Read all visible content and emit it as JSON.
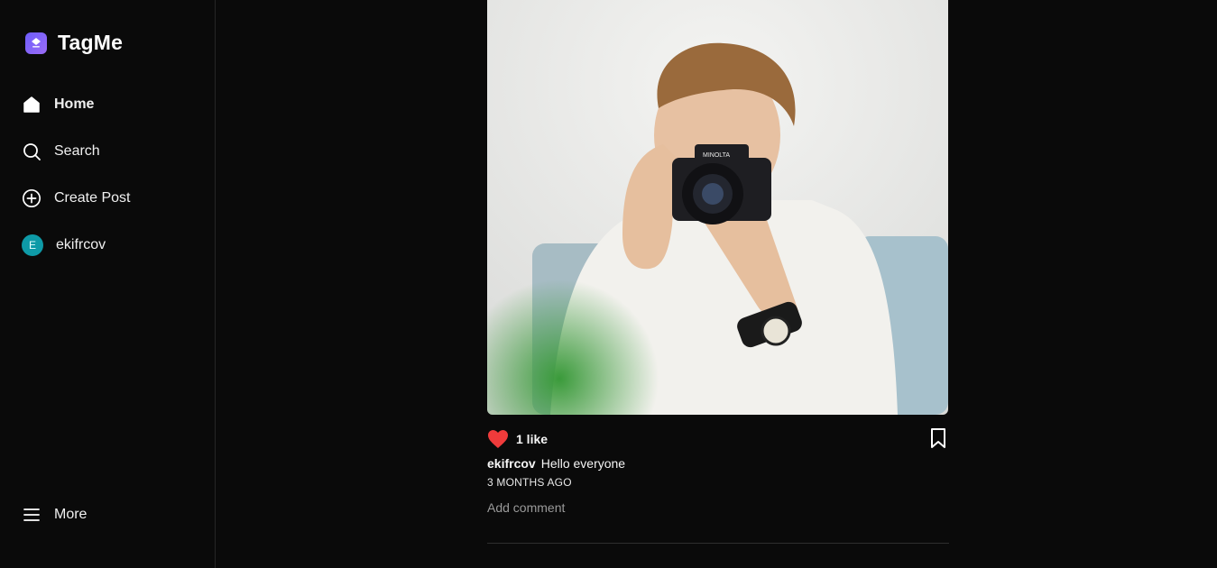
{
  "app": {
    "name": "TagMe",
    "logo_text": "TagMe",
    "accent": "#7b61ff"
  },
  "sidebar": {
    "items": [
      {
        "label": "Home",
        "icon": "home-icon",
        "active": true
      },
      {
        "label": "Search",
        "icon": "search-icon"
      },
      {
        "label": "Create Post",
        "icon": "plus-circle-icon"
      },
      {
        "label": "ekifrcov",
        "icon": "avatar",
        "avatar_letter": "E",
        "avatar_color": "#0e9aa7"
      }
    ],
    "more_label": "More"
  },
  "post": {
    "likes": "1 like",
    "username": "ekifrcov",
    "caption": "Hello everyone",
    "time": "3 MONTHS AGO",
    "comment_placeholder": "Add comment",
    "camera_brand": "MINOLTA",
    "liked_color": "#ef3b3b"
  }
}
